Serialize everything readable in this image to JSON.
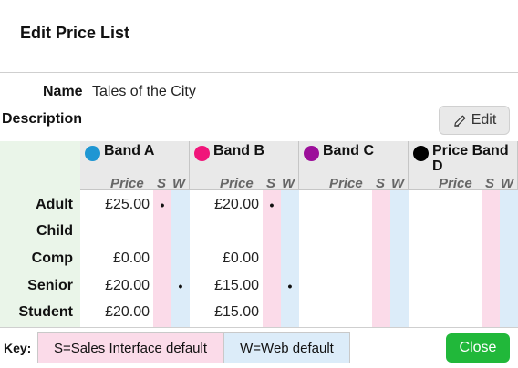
{
  "dialog": {
    "title": "Edit Price List"
  },
  "form": {
    "name_label": "Name",
    "name_value": "Tales of the City",
    "description_label": "Description",
    "edit_label": "Edit"
  },
  "columns": {
    "price": "Price",
    "s": "S",
    "w": "W"
  },
  "rows": [
    "Adult",
    "Child",
    "Comp",
    "Senior",
    "Student"
  ],
  "bands": [
    {
      "name": "Band A",
      "color": "#1f96d3",
      "prices": [
        "£25.00",
        "",
        "£0.00",
        "£20.00",
        "£20.00"
      ],
      "s": [
        "•",
        "",
        "",
        "",
        ""
      ],
      "w": [
        "",
        "",
        "",
        "•",
        ""
      ]
    },
    {
      "name": "Band B",
      "color": "#f0157a",
      "prices": [
        "£20.00",
        "",
        "£0.00",
        "£15.00",
        "£15.00"
      ],
      "s": [
        "•",
        "",
        "",
        "",
        ""
      ],
      "w": [
        "",
        "",
        "",
        "•",
        ""
      ]
    },
    {
      "name": "Band C",
      "color": "#9c0f9a",
      "prices": [
        "",
        "",
        "",
        "",
        ""
      ],
      "s": [
        "",
        "",
        "",
        "",
        ""
      ],
      "w": [
        "",
        "",
        "",
        "",
        ""
      ]
    },
    {
      "name": "Price Band D",
      "color": "#000000",
      "prices": [
        "",
        "",
        "",
        "",
        ""
      ],
      "s": [
        "",
        "",
        "",
        "",
        ""
      ],
      "w": [
        "",
        "",
        "",
        "",
        ""
      ]
    }
  ],
  "footer": {
    "key_label": "Key:",
    "key_s": "S=Sales Interface default",
    "key_w": "W=Web default",
    "close_label": "Close"
  }
}
